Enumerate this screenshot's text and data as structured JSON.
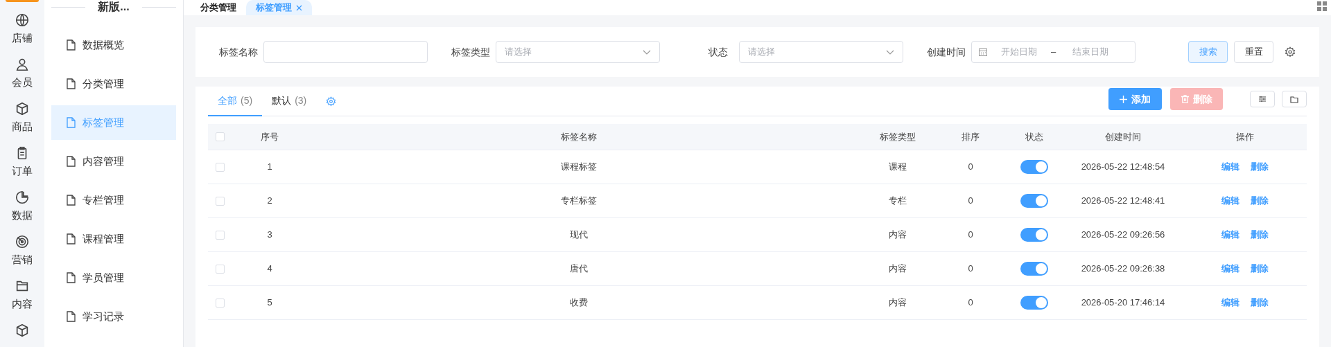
{
  "rail": {
    "items": [
      {
        "label": "店铺"
      },
      {
        "label": "会员"
      },
      {
        "label": "商品"
      },
      {
        "label": "订单"
      },
      {
        "label": "数据"
      },
      {
        "label": "营销"
      },
      {
        "label": "内容"
      },
      {
        "kind": "icon_only"
      }
    ]
  },
  "sidebar": {
    "title": "新版...",
    "items": [
      {
        "label": "数据概览",
        "selected": false
      },
      {
        "label": "分类管理",
        "selected": false
      },
      {
        "label": "标签管理",
        "selected": true
      },
      {
        "label": "内容管理",
        "selected": false
      },
      {
        "label": "专栏管理",
        "selected": false
      },
      {
        "label": "课程管理",
        "selected": false
      },
      {
        "label": "学员管理",
        "selected": false
      },
      {
        "label": "学习记录",
        "selected": false
      }
    ]
  },
  "page_tabs": [
    {
      "label": "分类管理",
      "selected": false,
      "closable": false
    },
    {
      "label": "标签管理",
      "selected": true,
      "closable": true
    }
  ],
  "filters": {
    "fields": [
      {
        "kind": "text",
        "label": "标签名称"
      },
      {
        "kind": "select",
        "label": "标签类型",
        "placeholder": "请选择"
      },
      {
        "kind": "select",
        "label": "状态",
        "placeholder": "请选择"
      },
      {
        "kind": "daterange",
        "label": "创建时间",
        "start_placeholder": "开始日期",
        "separator": "–",
        "end_placeholder": "结束日期"
      }
    ],
    "search_button": "搜索",
    "reset_button": "重置"
  },
  "list_tabs": [
    {
      "label": "全部",
      "count": "(5)",
      "selected": true
    },
    {
      "label": "默认",
      "count": "(3)",
      "selected": false
    }
  ],
  "add_button": {
    "label": "添加",
    "disabled": false
  },
  "delete_button": {
    "label": "删除",
    "disabled": true
  },
  "table": {
    "columns": [
      "序号",
      "标签名称",
      "标签类型",
      "排序",
      "状态",
      "创建时间",
      "操作"
    ],
    "header_checked": false,
    "rows": [
      {
        "checked": false,
        "index": "1",
        "name": "课程标签",
        "type": "课程",
        "sort": "0",
        "on": true,
        "created": "2026-05-22 12:48:54",
        "actions": [
          "编辑",
          "删除"
        ]
      },
      {
        "checked": false,
        "index": "2",
        "name": "专栏标签",
        "type": "专栏",
        "sort": "0",
        "on": true,
        "created": "2026-05-22 12:48:41",
        "actions": [
          "编辑",
          "删除"
        ]
      },
      {
        "checked": false,
        "index": "3",
        "name": "现代",
        "type": "内容",
        "sort": "0",
        "on": true,
        "created": "2026-05-22 09:26:56",
        "actions": [
          "编辑",
          "删除"
        ]
      },
      {
        "checked": false,
        "index": "4",
        "name": "唐代",
        "type": "内容",
        "sort": "0",
        "on": true,
        "created": "2026-05-22 09:26:38",
        "actions": [
          "编辑",
          "删除"
        ]
      },
      {
        "checked": false,
        "index": "5",
        "name": "收费",
        "type": "内容",
        "sort": "0",
        "on": true,
        "created": "2026-05-20 17:46:14",
        "actions": [
          "编辑",
          "删除"
        ]
      }
    ]
  }
}
